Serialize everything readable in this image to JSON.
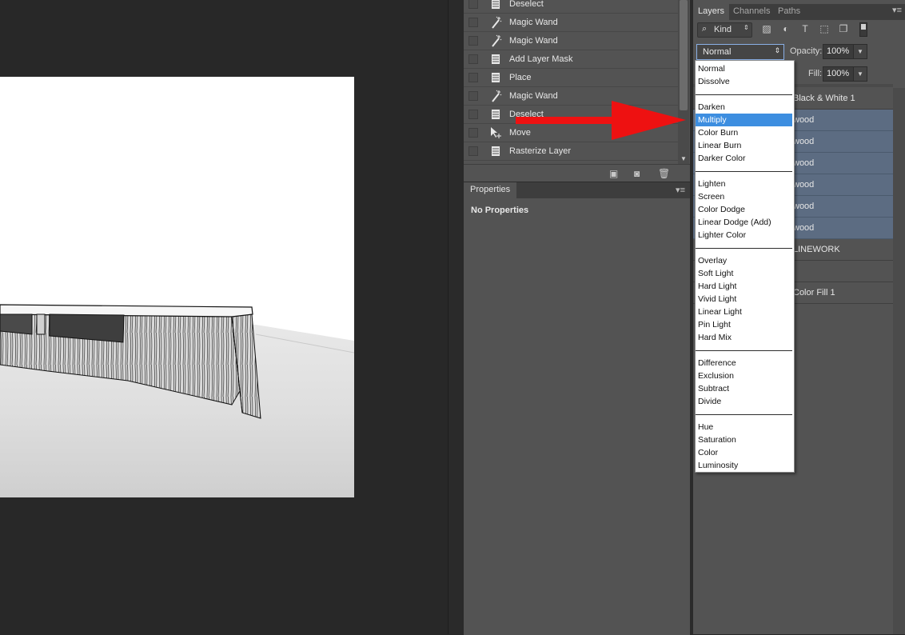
{
  "history": {
    "items": [
      {
        "label": "Deselect",
        "icon": "document-icon"
      },
      {
        "label": "Magic Wand",
        "icon": "magic-wand-icon"
      },
      {
        "label": "Magic Wand",
        "icon": "magic-wand-icon"
      },
      {
        "label": "Add Layer Mask",
        "icon": "document-icon"
      },
      {
        "label": "Place",
        "icon": "document-icon"
      },
      {
        "label": "Magic Wand",
        "icon": "magic-wand-icon"
      },
      {
        "label": "Deselect",
        "icon": "document-icon"
      },
      {
        "label": "Move",
        "icon": "move-icon"
      },
      {
        "label": "Rasterize Layer",
        "icon": "document-icon"
      }
    ],
    "footer_icons": [
      "new-document-icon",
      "camera-icon",
      "trash-icon"
    ]
  },
  "properties": {
    "tab": "Properties",
    "empty_text": "No Properties"
  },
  "layers": {
    "tabs": [
      "Layers",
      "Channels",
      "Paths"
    ],
    "active_tab": "Layers",
    "kind_label": "Kind",
    "filter_icons": [
      "image-icon",
      "adjustment-icon",
      "type-icon",
      "shape-icon",
      "smart-object-icon"
    ],
    "blend_mode": "Normal",
    "opacity_label": "Opacity:",
    "opacity_value": "100%",
    "fill_label": "Fill:",
    "fill_value": "100%",
    "rows": [
      {
        "name": "Black & White 1",
        "selected": false
      },
      {
        "name": "wood",
        "selected": true
      },
      {
        "name": "wood",
        "selected": true
      },
      {
        "name": "wood",
        "selected": true
      },
      {
        "name": "wood",
        "selected": true
      },
      {
        "name": "wood",
        "selected": true
      },
      {
        "name": "wood",
        "selected": true
      },
      {
        "name": "LINEWORK",
        "selected": false
      },
      {
        "name": "",
        "selected": false
      },
      {
        "name": "Color Fill 1",
        "selected": false
      }
    ]
  },
  "blend_dropdown": {
    "highlighted": "Multiply",
    "groups": [
      [
        "Normal",
        "Dissolve"
      ],
      [
        "Darken",
        "Multiply",
        "Color Burn",
        "Linear Burn",
        "Darker Color"
      ],
      [
        "Lighten",
        "Screen",
        "Color Dodge",
        "Linear Dodge (Add)",
        "Lighter Color"
      ],
      [
        "Overlay",
        "Soft Light",
        "Hard Light",
        "Vivid Light",
        "Linear Light",
        "Pin Light",
        "Hard Mix"
      ],
      [
        "Difference",
        "Exclusion",
        "Subtract",
        "Divide"
      ],
      [
        "Hue",
        "Saturation",
        "Color",
        "Luminosity"
      ]
    ]
  },
  "colors": {
    "panel_bg": "#535353",
    "selected_layer": "#5c6c82",
    "highlight": "#3d8ee0",
    "annotation_arrow": "#ee1111"
  }
}
